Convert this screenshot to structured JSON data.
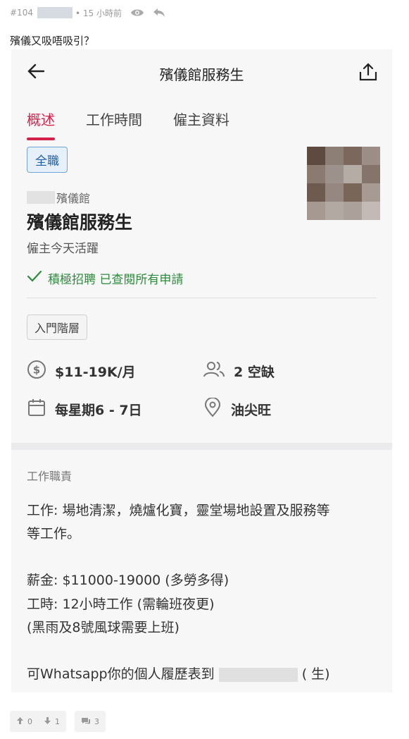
{
  "post": {
    "number": "#104",
    "time": "• 15 小時前",
    "title": "殯儀又吸唔吸引？"
  },
  "app": {
    "page_title": "殯儀館服務生",
    "tabs": [
      {
        "label": "概述",
        "active": true
      },
      {
        "label": "工作時間",
        "active": false
      },
      {
        "label": "僱主資料",
        "active": false
      }
    ],
    "employment_type": "全職",
    "employer_suffix": "殯儀館",
    "job_title": "殯儀館服務生",
    "employer_activity": "僱主今天活躍",
    "hiring_status": "積極招聘 已查閱所有申請",
    "level": "入門階層",
    "salary": "$11-19K/月",
    "vacancies": "2 空缺",
    "schedule": "每星期6 - 7日",
    "location": "油尖旺",
    "duties_heading": "工作職責",
    "duties_line1": "工作: 場地清潔，燒爐化寶，靈堂場地設置及服務等",
    "duties_line2": "等工作。",
    "salary_detail": "薪金: $11000-19000 (多勞多得)",
    "hours_detail": "工時: 12小時工作 (需輪班夜更)",
    "weather_detail": "(黑雨及8號風球需要上班)",
    "contact_prefix": "可Whatsapp你的個人履歷表到",
    "contact_suffix": "(   生)"
  },
  "actions": {
    "upvotes": "0",
    "downvotes": "1",
    "replies": "3"
  },
  "colors": {
    "accent_red": "#d4224b",
    "hiring_green": "#2e8b3e",
    "chip_blue": "#1f5fa8"
  }
}
